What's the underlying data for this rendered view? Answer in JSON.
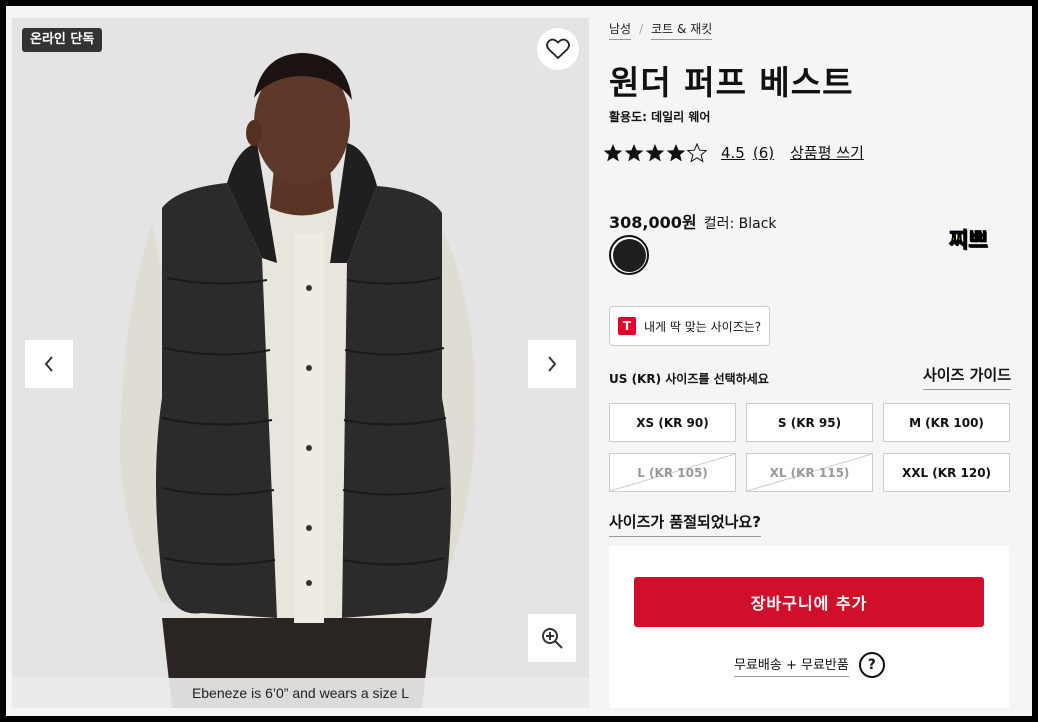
{
  "image": {
    "badge": "온라인 단독",
    "caption": "Ebeneze is 6’0” and wears a size L",
    "icons": [
      "heart-icon",
      "chevron-left-icon",
      "chevron-right-icon",
      "zoom-in-icon"
    ]
  },
  "breadcrumb": [
    "남성",
    "코트 & 재킷"
  ],
  "product": {
    "title": "원더 퍼프 베스트",
    "usage": "활용도: 데일리 웨어",
    "rating": "4.5",
    "rating_stars": 4.5,
    "review_count": "(6)",
    "write_review": "상품평 쓰기",
    "price": "308,000원",
    "color_label": "컬러: Black",
    "swatch_color": "#1e1e1e",
    "sticker": "찌쁘"
  },
  "fit_finder": {
    "logo": "T",
    "label": "내게 딱 맞는 사이즈는?"
  },
  "sizes": {
    "label": "US (KR) 사이즈를 선택하세요",
    "guide": "사이즈 가이드",
    "options": [
      {
        "label": "XS (KR 90)",
        "available": true
      },
      {
        "label": "S (KR 95)",
        "available": true
      },
      {
        "label": "M (KR 100)",
        "available": true
      },
      {
        "label": "L (KR 105)",
        "available": false
      },
      {
        "label": "XL (KR 115)",
        "available": false
      },
      {
        "label": "XXL (KR 120)",
        "available": true
      }
    ],
    "out_of_stock_link": "사이즈가 품절되었나요?"
  },
  "cart": {
    "add_label": "장바구니에 추가",
    "shipping": "무료배송 + 무료반품",
    "help": "?",
    "accent": "#d0102b"
  }
}
